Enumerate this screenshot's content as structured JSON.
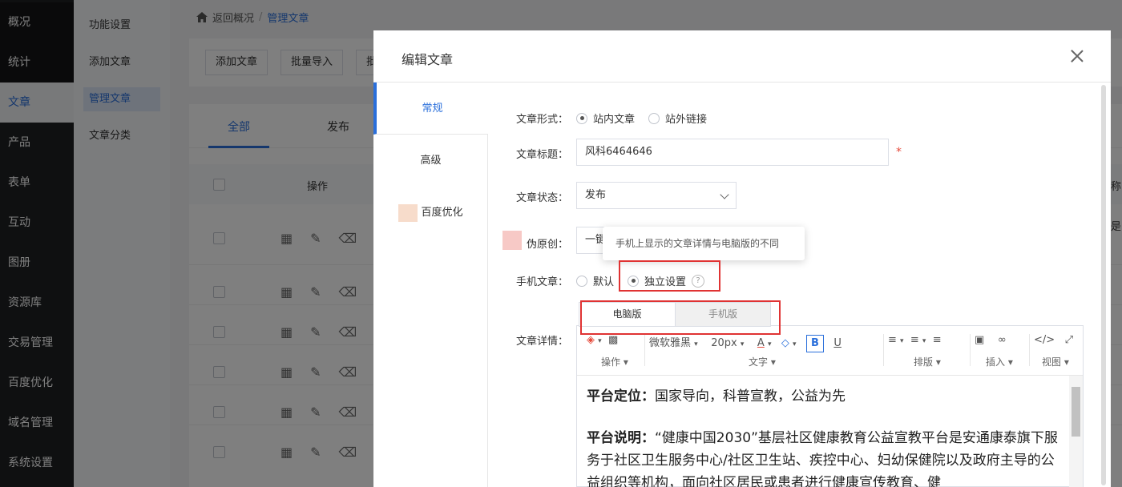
{
  "nav": {
    "items": [
      {
        "label": "概况"
      },
      {
        "label": "统计"
      },
      {
        "label": "文章"
      },
      {
        "label": "产品"
      },
      {
        "label": "表单"
      },
      {
        "label": "互动"
      },
      {
        "label": "图册"
      },
      {
        "label": "资源库"
      },
      {
        "label": "交易管理"
      },
      {
        "label": "百度优化"
      },
      {
        "label": "域名管理"
      },
      {
        "label": "系统设置"
      }
    ]
  },
  "subnav": {
    "items": [
      {
        "label": "功能设置"
      },
      {
        "label": "添加文章"
      },
      {
        "label": "管理文章"
      },
      {
        "label": "文章分类"
      }
    ]
  },
  "breadcrumb": {
    "back": "返回概况",
    "sep": "/",
    "current": "管理文章"
  },
  "toolbar": {
    "add": "添加文章",
    "import": "批量导入",
    "third": "批"
  },
  "list": {
    "tabs": [
      "全部",
      "发布"
    ],
    "col_action": "操作",
    "edge_1": "称",
    "edge_2": "是"
  },
  "modal": {
    "title": "编辑文章",
    "tabs": [
      "常规",
      "高级",
      "百度优化"
    ],
    "form": {
      "type_label": "文章形式：",
      "type_opt1": "站内文章",
      "type_opt2": "站外链接",
      "title_label": "文章标题：",
      "title_value": "风科6464646",
      "required_mark": "*",
      "status_label": "文章状态：",
      "status_value": "发布",
      "pseudo_label": "伪原创：",
      "pseudo_value": "一键",
      "mobile_label": "手机文章：",
      "mobile_opt1": "默认",
      "mobile_opt2": "独立设置",
      "help_char": "?",
      "tooltip": "手机上显示的文章详情与电脑版的不同",
      "detail_label": "文章详情：",
      "view_pc": "电脑版",
      "view_mobile": "手机版"
    },
    "editor": {
      "font": "微软雅黑",
      "size": "20px",
      "group_labels": [
        "操作",
        "文字",
        "排版",
        "插入",
        "视图"
      ],
      "p1_strong": "平台定位：",
      "p1_text": "国家导向，科普宣教，公益为先",
      "p2_strong": "平台说明：",
      "p2_text": "“健康中国2030”基层社区健康教育公益宣教平台是安通康泰旗下服务于社区卫生服务中心/社区卫生站、疾控中心、妇幼保健院以及政府主导的公益组织等机构，面向社区居民或患者进行健康宣传教育、健"
    }
  }
}
